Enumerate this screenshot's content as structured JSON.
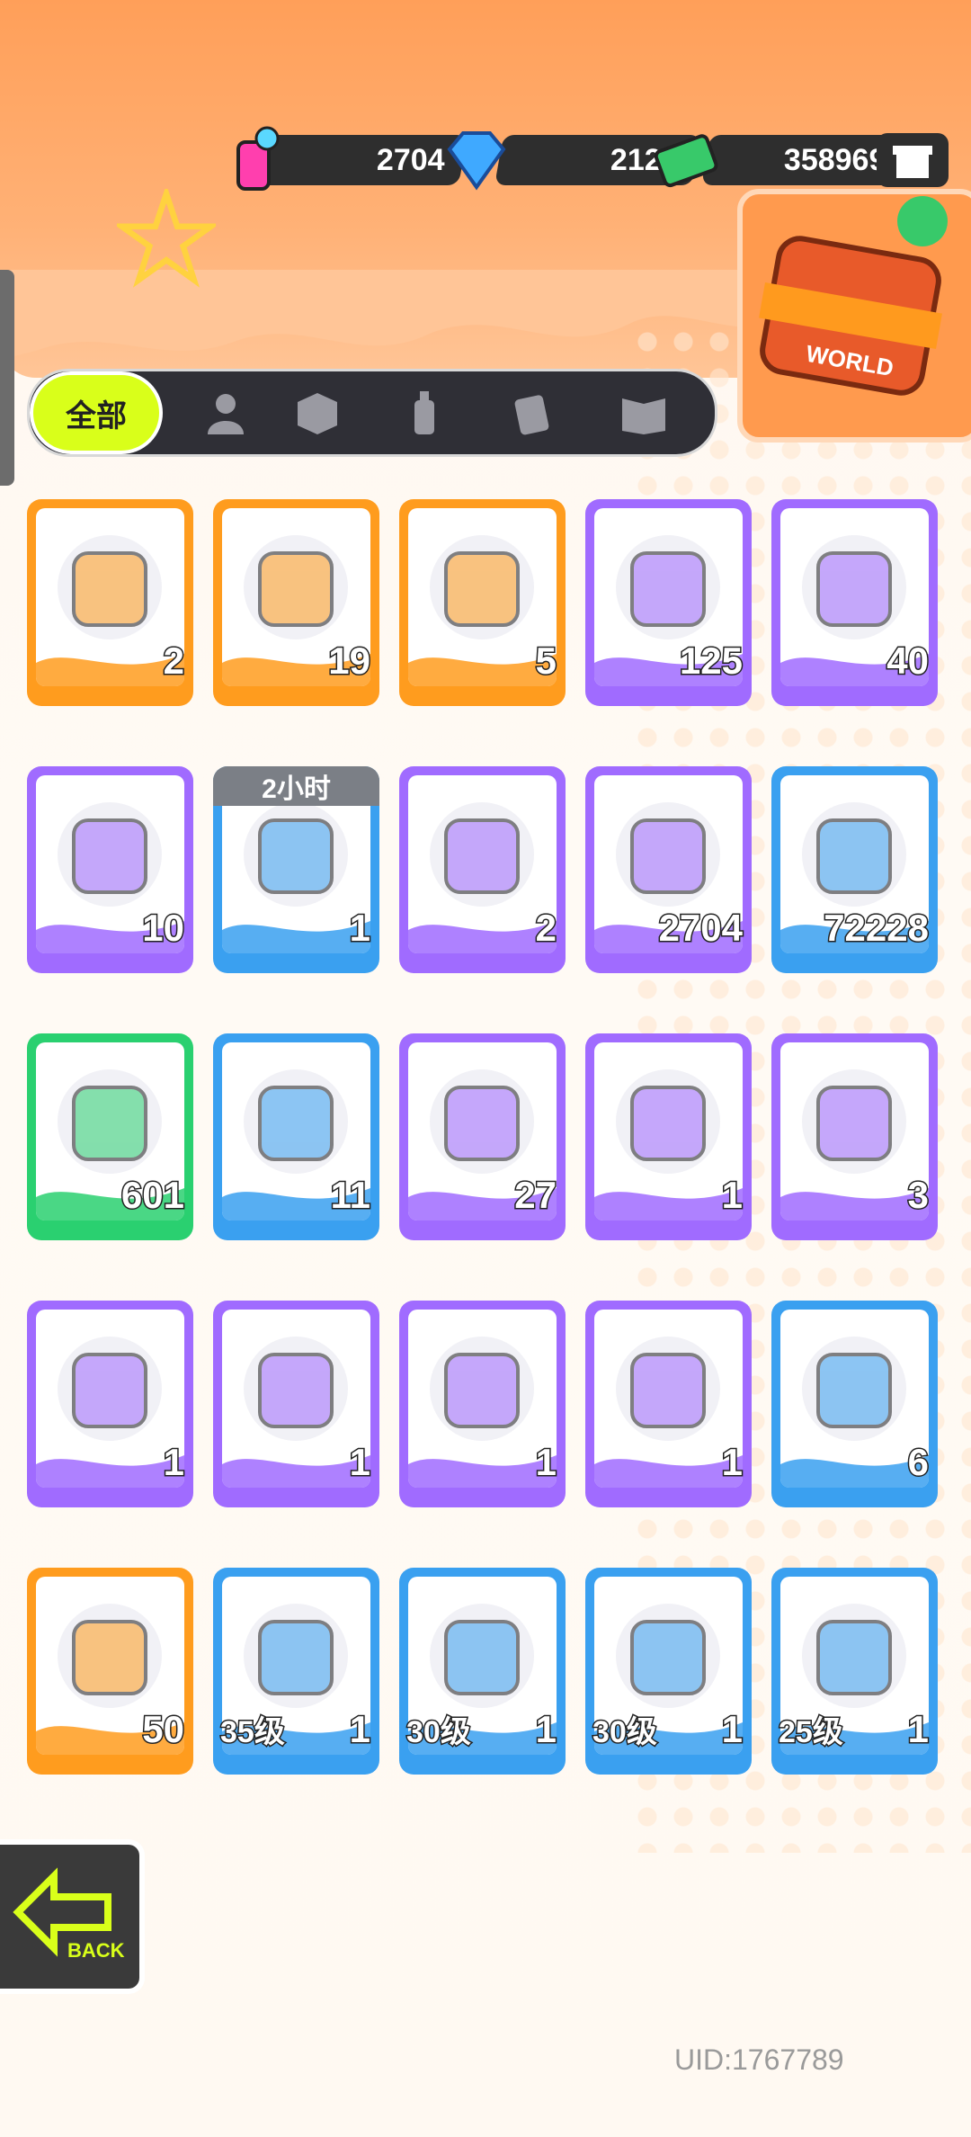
{
  "currencies": [
    {
      "name": "spray-currency",
      "value": "2704"
    },
    {
      "name": "diamond-currency",
      "value": "2120"
    },
    {
      "name": "cash-currency",
      "value": "358969"
    }
  ],
  "world_card": {
    "label": "WORLD"
  },
  "tabs": {
    "all_label": "全部",
    "icons": [
      "person-icon",
      "box-icon",
      "spray-can-icon",
      "cards-icon",
      "book-icon"
    ]
  },
  "items": [
    {
      "icon": "gold-ticket-icon",
      "count": "2",
      "frame": "orange"
    },
    {
      "icon": "purple-ticket-icon",
      "count": "19",
      "frame": "orange"
    },
    {
      "icon": "rainbow-star-icon",
      "count": "5",
      "frame": "orange"
    },
    {
      "icon": "blue-star-icon",
      "count": "125",
      "frame": "purple"
    },
    {
      "icon": "mystery-deity-badge-icon",
      "count": "40",
      "frame": "purple"
    },
    {
      "icon": "travel-card-icon",
      "count": "10",
      "frame": "purple"
    },
    {
      "icon": "alarm-clock-icon",
      "count": "1",
      "frame": "blue",
      "timer": "2小时"
    },
    {
      "icon": "green-cup-icon",
      "count": "2",
      "frame": "purple"
    },
    {
      "icon": "spray-can-icon",
      "count": "2704",
      "frame": "purple"
    },
    {
      "icon": "paint-tube-icon",
      "count": "72228",
      "frame": "blue"
    },
    {
      "icon": "green-tape-icon",
      "count": "601",
      "frame": "green"
    },
    {
      "icon": "blue-tape-icon",
      "count": "11",
      "frame": "blue"
    },
    {
      "icon": "purple-tape-icon",
      "count": "27",
      "frame": "purple"
    },
    {
      "icon": "deity-avatar-silver-hair-icon",
      "count": "1",
      "frame": "purple"
    },
    {
      "icon": "deity-avatar-orange-hair-icon",
      "count": "3",
      "frame": "purple"
    },
    {
      "icon": "deity-avatar-green-hat-icon",
      "count": "1",
      "frame": "purple"
    },
    {
      "icon": "deity-avatar-dark-hair-icon",
      "count": "1",
      "frame": "purple"
    },
    {
      "icon": "deity-avatar-blonde-braid-icon",
      "count": "1",
      "frame": "purple"
    },
    {
      "icon": "deity-avatar-blonde-icon",
      "count": "1",
      "frame": "purple"
    },
    {
      "icon": "blue-sticker-pack-icon",
      "count": "6",
      "frame": "blue"
    },
    {
      "icon": "orange-sticker-pack-icon",
      "count": "50",
      "frame": "orange"
    },
    {
      "icon": "green-bag-icon",
      "count": "1",
      "frame": "blue",
      "level": "35级"
    },
    {
      "icon": "water-gun-icon",
      "count": "1",
      "frame": "blue",
      "level": "30级"
    },
    {
      "icon": "ring-icon",
      "count": "1",
      "frame": "blue",
      "level": "30级"
    },
    {
      "icon": "crossbow-icon",
      "count": "1",
      "frame": "blue",
      "level": "25级"
    }
  ],
  "back_button": {
    "label": "BACK"
  },
  "uid": "UID:1767789",
  "colors": {
    "orange": "#ff9c1e",
    "purple": "#a06bff",
    "blue": "#3aa0f0",
    "green": "#2ad070",
    "accent": "#d9ff1a"
  }
}
